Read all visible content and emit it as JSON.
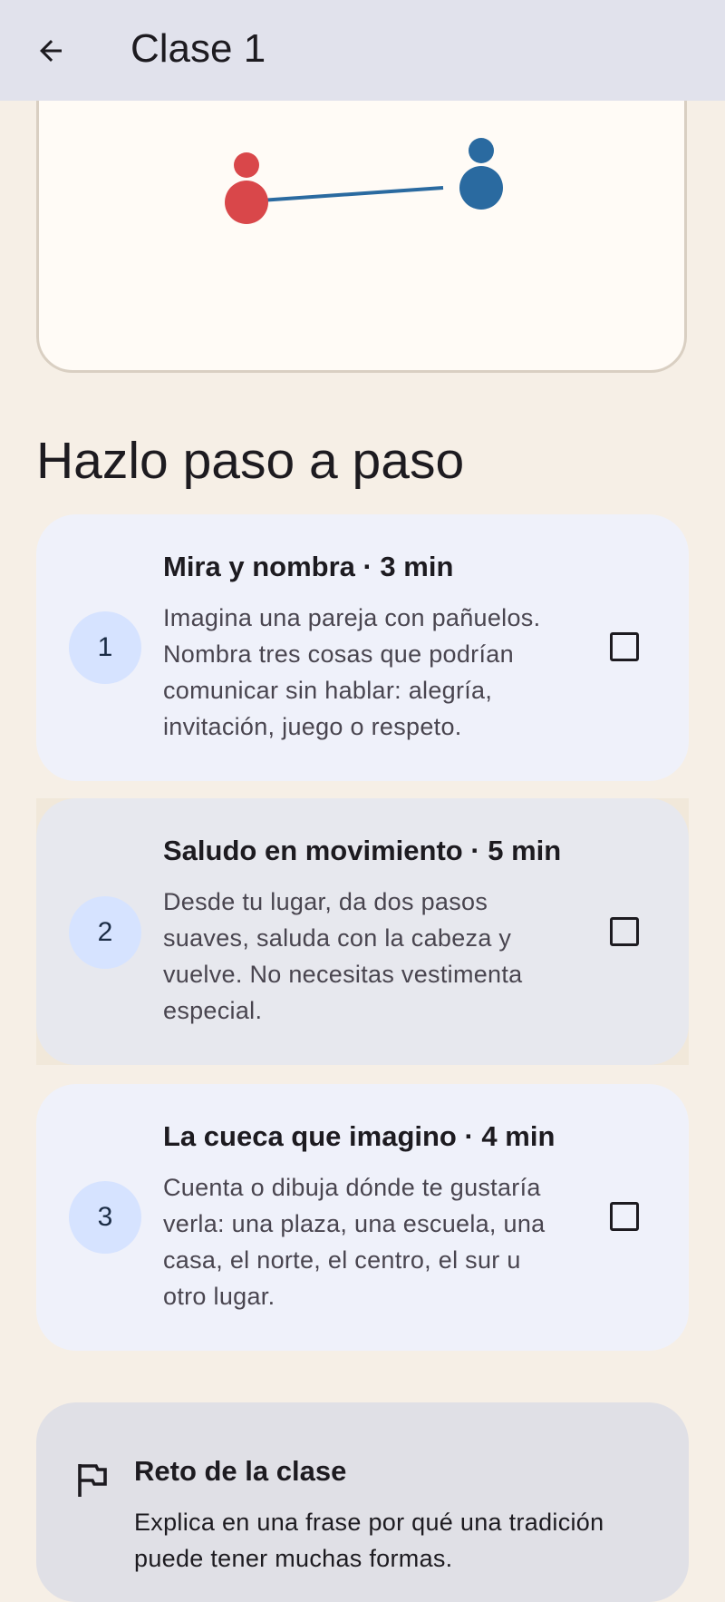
{
  "appbar": {
    "title": "Clase 1",
    "back_icon": "arrow-back-icon"
  },
  "illustration": {
    "left_figure_color": "#d9474a",
    "right_figure_color": "#2a6aa0",
    "line_color": "#2a6aa0"
  },
  "section": {
    "title": "Hazlo paso a paso"
  },
  "steps": [
    {
      "number": "1",
      "title": "Mira y nombra · 3 min",
      "description": "Imagina una pareja con pañuelos. Nombra tres cosas que podrían comunicar sin hablar: alegría, invitación, juego o respeto.",
      "checked": false
    },
    {
      "number": "2",
      "title": "Saludo en movimiento · 5 min",
      "description": "Desde tu lugar, da dos pasos suaves, saluda con la cabeza y vuelve. No necesitas vestimenta especial.",
      "checked": false
    },
    {
      "number": "3",
      "title": "La cueca que imagino · 4 min",
      "description": "Cuenta o dibuja dónde te gustaría verla: una plaza, una escuela, una casa, el norte, el centro, el sur u otro lugar.",
      "checked": false
    }
  ],
  "challenge": {
    "icon": "flag-icon",
    "title": "Reto de la clase",
    "description": "Explica en una frase por qué una tradición puede tener muchas formas."
  }
}
